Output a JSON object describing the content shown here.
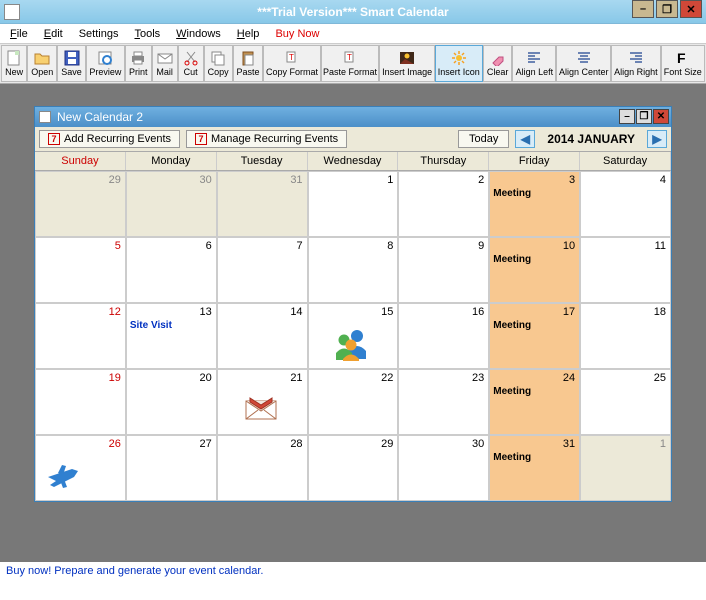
{
  "app": {
    "title": "***Trial Version*** Smart Calendar"
  },
  "menu": {
    "file": "File",
    "edit": "Edit",
    "settings": "Settings",
    "tools": "Tools",
    "windows": "Windows",
    "help": "Help",
    "buynow": "Buy Now"
  },
  "toolbar": {
    "new": "New",
    "open": "Open",
    "save": "Save",
    "preview": "Preview",
    "print": "Print",
    "mail": "Mail",
    "cut": "Cut",
    "copy": "Copy",
    "paste": "Paste",
    "copy_format": "Copy Format",
    "paste_format": "Paste Format",
    "insert_image": "Insert Image",
    "insert_icon": "Insert Icon",
    "clear": "Clear",
    "align_left": "Align Left",
    "align_center": "Align Center",
    "align_right": "Align Right",
    "font_size": "Font Size"
  },
  "subwin": {
    "title": "New Calendar 2",
    "add_recurring": "Add Recurring Events",
    "manage_recurring": "Manage Recurring Events",
    "today": "Today",
    "month": "2014 JANUARY"
  },
  "daynames": [
    "Sunday",
    "Monday",
    "Tuesday",
    "Wednesday",
    "Thursday",
    "Friday",
    "Saturday"
  ],
  "cells": [
    {
      "num": "29",
      "cls": "other"
    },
    {
      "num": "30",
      "cls": "other"
    },
    {
      "num": "31",
      "cls": "other"
    },
    {
      "num": "1",
      "cls": "curr"
    },
    {
      "num": "2",
      "cls": "curr"
    },
    {
      "num": "3",
      "cls": "curr highlight",
      "event": "Meeting"
    },
    {
      "num": "4",
      "cls": "curr"
    },
    {
      "num": "5",
      "cls": "curr sun"
    },
    {
      "num": "6",
      "cls": "curr"
    },
    {
      "num": "7",
      "cls": "curr"
    },
    {
      "num": "8",
      "cls": "curr"
    },
    {
      "num": "9",
      "cls": "curr"
    },
    {
      "num": "10",
      "cls": "curr highlight",
      "event": "Meeting"
    },
    {
      "num": "11",
      "cls": "curr"
    },
    {
      "num": "12",
      "cls": "curr sun"
    },
    {
      "num": "13",
      "cls": "curr",
      "event": "Site Visit",
      "evtcls": "blue"
    },
    {
      "num": "14",
      "cls": "curr"
    },
    {
      "num": "15",
      "cls": "curr",
      "icon": "people"
    },
    {
      "num": "16",
      "cls": "curr"
    },
    {
      "num": "17",
      "cls": "curr highlight",
      "event": "Meeting"
    },
    {
      "num": "18",
      "cls": "curr"
    },
    {
      "num": "19",
      "cls": "curr sun"
    },
    {
      "num": "20",
      "cls": "curr"
    },
    {
      "num": "21",
      "cls": "curr",
      "icon": "mail"
    },
    {
      "num": "22",
      "cls": "curr"
    },
    {
      "num": "23",
      "cls": "curr"
    },
    {
      "num": "24",
      "cls": "curr highlight",
      "event": "Meeting"
    },
    {
      "num": "25",
      "cls": "curr"
    },
    {
      "num": "26",
      "cls": "curr sun",
      "icon": "plane"
    },
    {
      "num": "27",
      "cls": "curr"
    },
    {
      "num": "28",
      "cls": "curr"
    },
    {
      "num": "29",
      "cls": "curr"
    },
    {
      "num": "30",
      "cls": "curr"
    },
    {
      "num": "31",
      "cls": "curr highlight",
      "event": "Meeting"
    },
    {
      "num": "1",
      "cls": "other"
    }
  ],
  "footer": "Buy now! Prepare and generate your event calendar."
}
